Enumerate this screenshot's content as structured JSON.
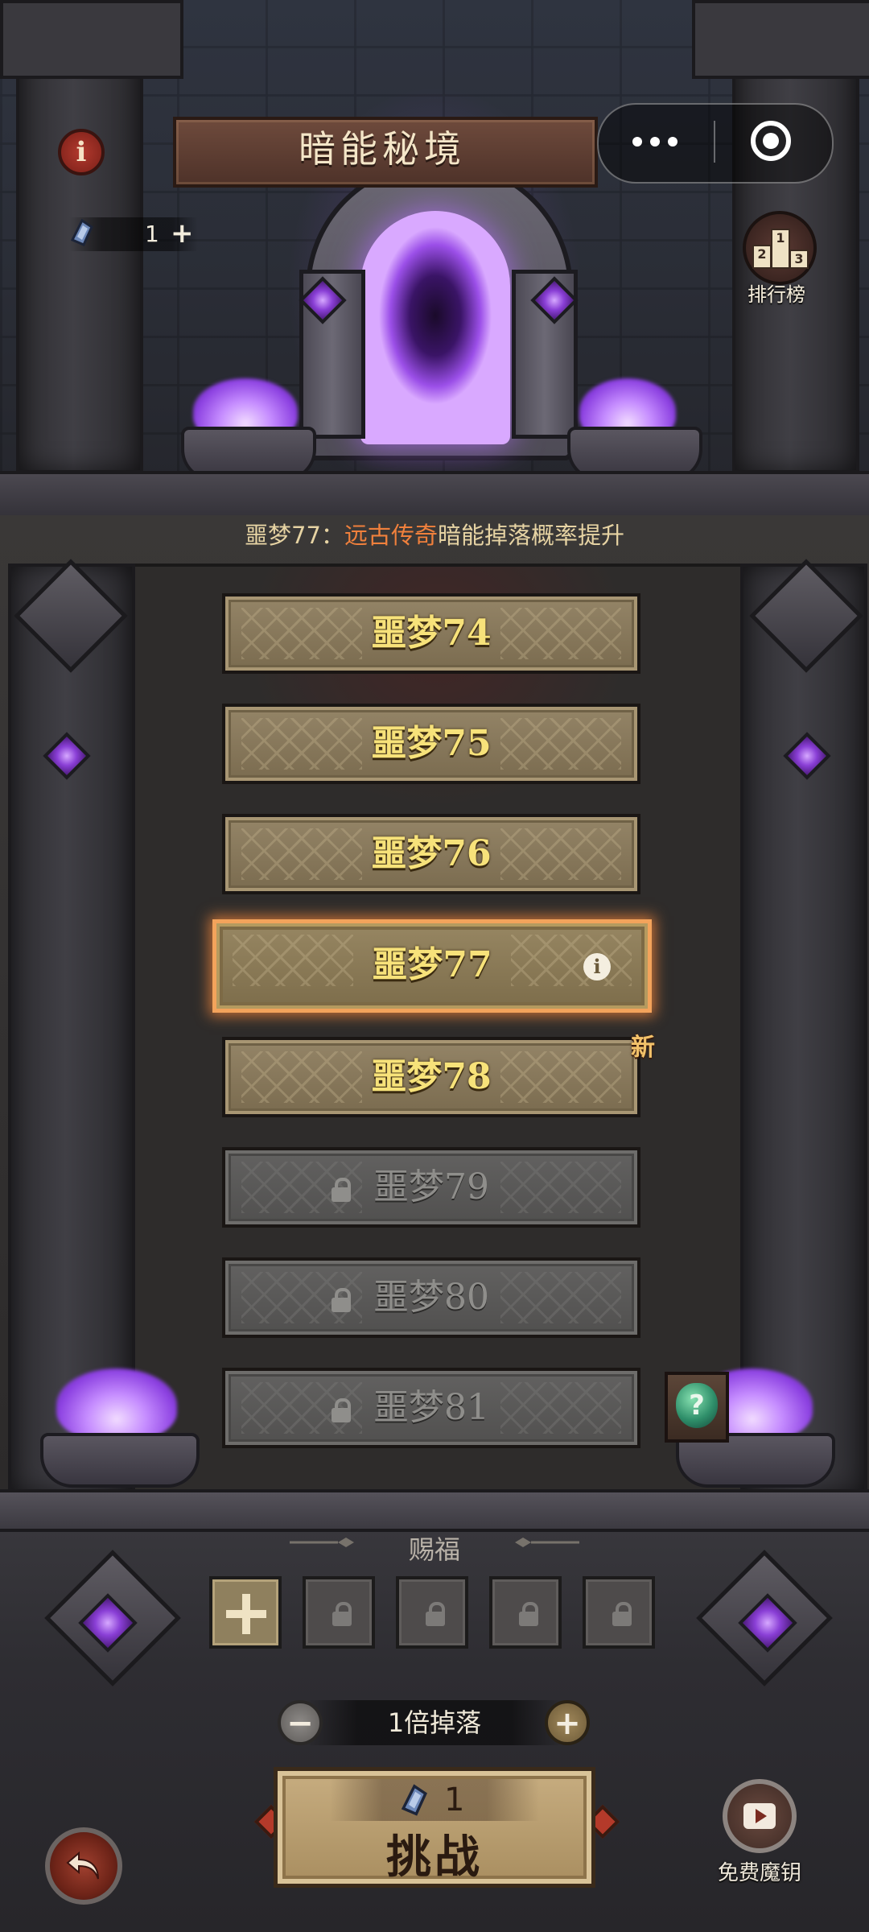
{
  "header": {
    "title": "暗能秘境",
    "info_icon": "i"
  },
  "mini_program_capsule": {
    "more_icon": "more-dots-icon",
    "close_icon": "target-close-icon"
  },
  "keys": {
    "count": "1",
    "add": "+"
  },
  "leaderboard": {
    "label": "排行榜",
    "podium": [
      "2",
      "1",
      "3"
    ]
  },
  "notice": {
    "prefix": "噩梦77：",
    "highlight": "远古传奇",
    "suffix": "暗能掉落概率提升",
    "highlight_color": "#f0803c"
  },
  "levels": [
    {
      "label": "噩梦74",
      "state": "unlocked"
    },
    {
      "label": "噩梦75",
      "state": "unlocked"
    },
    {
      "label": "噩梦76",
      "state": "unlocked"
    },
    {
      "label": "噩梦77",
      "state": "selected",
      "info_icon": "i"
    },
    {
      "label": "噩梦78",
      "state": "unlocked",
      "badge": "新"
    },
    {
      "label": "噩梦79",
      "state": "locked"
    },
    {
      "label": "噩梦80",
      "state": "locked"
    },
    {
      "label": "噩梦81",
      "state": "locked"
    }
  ],
  "mystery": {
    "glyph": "?"
  },
  "blessing": {
    "title": "赐福",
    "slots": [
      "add",
      "locked",
      "locked",
      "locked",
      "locked"
    ]
  },
  "drop": {
    "label": "1倍掉落",
    "minus": "−",
    "plus": "+"
  },
  "challenge": {
    "cost": "1",
    "label": "挑战"
  },
  "free_keys": {
    "label": "免费魔钥"
  },
  "colors": {
    "gold_text": "#f7e27a",
    "selected_border": "#f3a35b",
    "portal": "#9b4fe8"
  }
}
